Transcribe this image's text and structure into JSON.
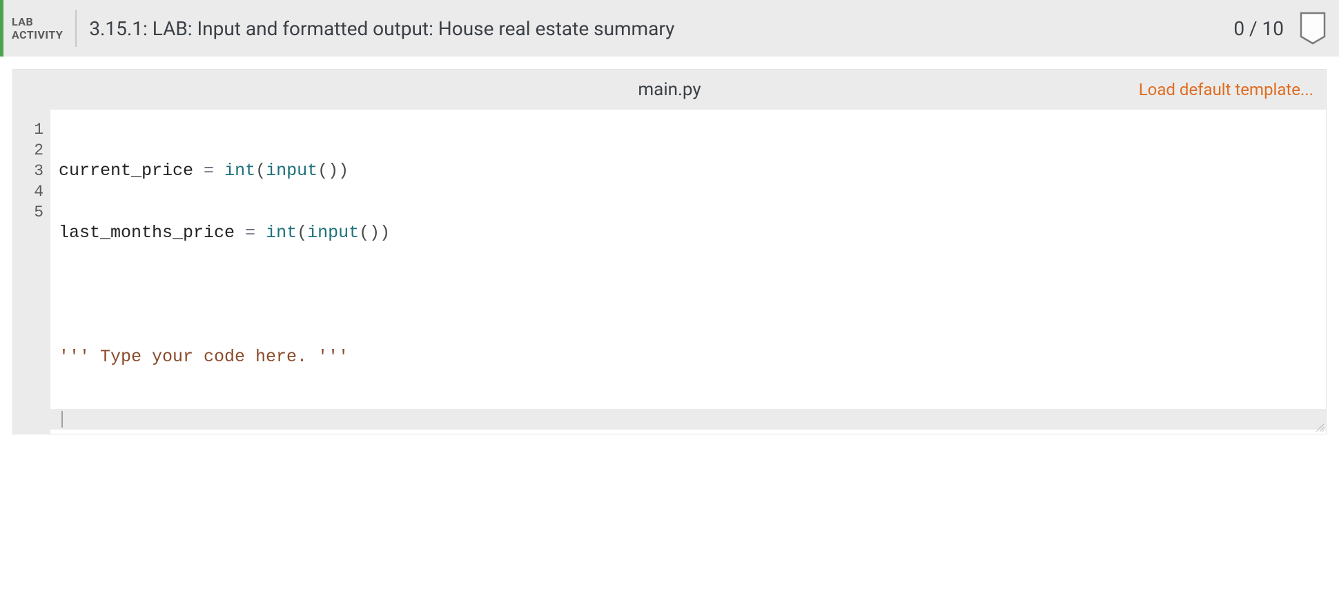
{
  "header": {
    "badge_line1": "LAB",
    "badge_line2": "ACTIVITY",
    "title": "3.15.1: LAB: Input and formatted output: House real estate summary",
    "score": "0 / 10"
  },
  "file": {
    "name": "main.py",
    "load_template_label": "Load default template..."
  },
  "code": {
    "line_count": 5,
    "active_line": 5,
    "lines": {
      "l1": {
        "id1": "current_price",
        "op": " = ",
        "builtin1": "int",
        "p1": "(",
        "builtin2": "input",
        "p2": "(",
        "p3": ")",
        "p4": ")"
      },
      "l2": {
        "id1": "last_months_price",
        "op": " = ",
        "builtin1": "int",
        "p1": "(",
        "builtin2": "input",
        "p2": "(",
        "p3": ")",
        "p4": ")"
      },
      "l3": "",
      "l4": {
        "str": "''' Type your code here. '''"
      },
      "l5": ""
    }
  }
}
